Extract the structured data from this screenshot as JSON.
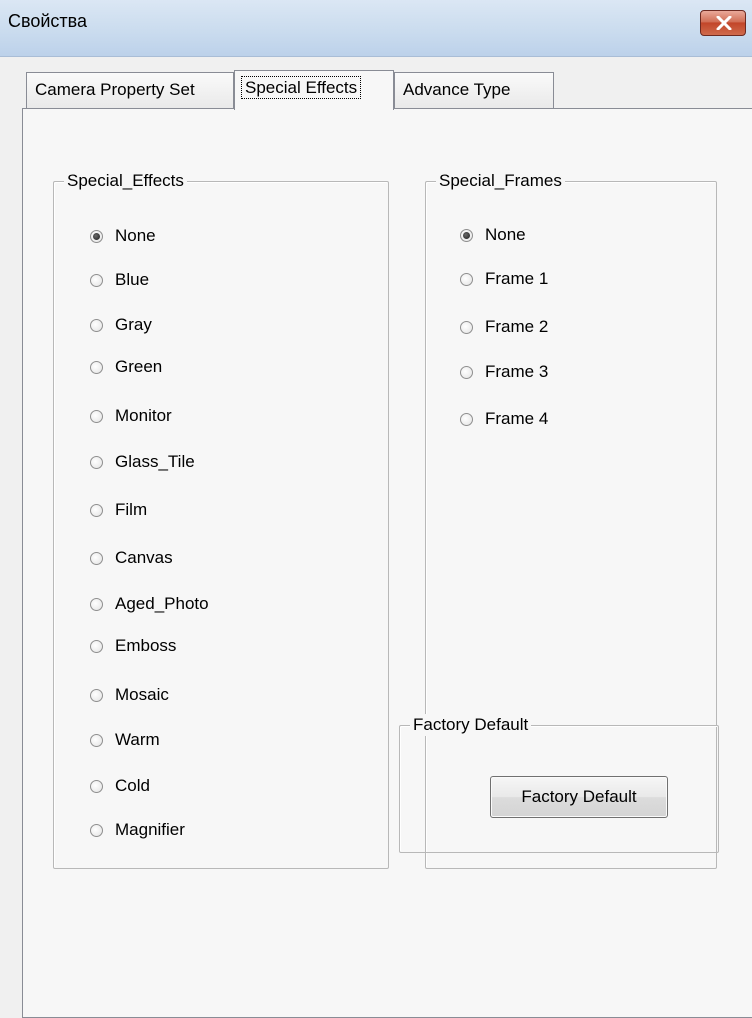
{
  "window": {
    "title": "Свойства"
  },
  "tabs": [
    {
      "label": "Camera Property Set",
      "active": false
    },
    {
      "label": "Special Effects",
      "active": true
    },
    {
      "label": "Advance Type",
      "active": false
    }
  ],
  "special_effects": {
    "caption": "Special_Effects",
    "selected": "None",
    "options": [
      "None",
      "Blue",
      "Gray",
      "Green",
      "Monitor",
      "Glass_Tile",
      "Film",
      "Canvas",
      "Aged_Photo",
      "Emboss",
      "Mosaic",
      "Warm",
      "Cold",
      "Magnifier"
    ]
  },
  "special_frames": {
    "caption": "Special_Frames",
    "selected": "None",
    "options": [
      "None",
      "Frame 1",
      "Frame 2",
      "Frame 3",
      "Frame 4"
    ]
  },
  "factory_default": {
    "caption": "Factory Default",
    "button_label": "Factory Default"
  },
  "colors": {
    "dialog_background": "#f0f0f0",
    "panel_background": "#f7f7f7",
    "close_button": "#c7503a"
  },
  "icons": {
    "close": "close-icon"
  }
}
